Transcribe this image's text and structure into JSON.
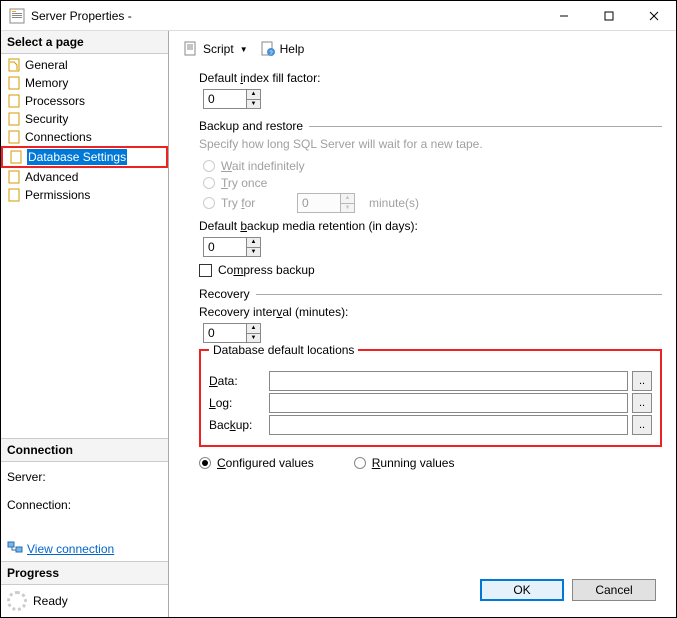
{
  "window": {
    "title": "Server Properties -"
  },
  "sidebar": {
    "header": "Select a page",
    "items": [
      {
        "label": "General"
      },
      {
        "label": "Memory"
      },
      {
        "label": "Processors"
      },
      {
        "label": "Security"
      },
      {
        "label": "Connections"
      },
      {
        "label": "Database Settings"
      },
      {
        "label": "Advanced"
      },
      {
        "label": "Permissions"
      }
    ],
    "connection": {
      "header": "Connection",
      "server_label": "Server:",
      "conn_label": "Connection:",
      "view_link": "View connection "
    },
    "progress": {
      "header": "Progress",
      "status": "Ready"
    }
  },
  "toolbar": {
    "script": "Script",
    "help": "Help"
  },
  "main": {
    "fill_factor_label": "Default index fill factor:",
    "fill_factor_value": "0",
    "backup_group": "Backup and restore",
    "backup_hint": "Specify how long SQL Server will wait for a new tape.",
    "wait_indef": "Wait indefinitely",
    "try_once": "Try once",
    "try_for": "Try for",
    "try_for_value": "0",
    "try_for_unit": "minute(s)",
    "retention_label": "Default backup media retention (in days):",
    "retention_value": "0",
    "compress_label": "Compress backup",
    "recovery_group": "Recovery",
    "recovery_label": "Recovery interval (minutes):",
    "recovery_value": "0",
    "locations_group": "Database default locations",
    "data_label": "Data:",
    "log_label": "Log:",
    "backup_label": "Backup:",
    "data_value": "",
    "log_value": "",
    "backup_value": "",
    "configured": "Configured values",
    "running": "Running values"
  },
  "footer": {
    "ok": "OK",
    "cancel": "Cancel"
  }
}
